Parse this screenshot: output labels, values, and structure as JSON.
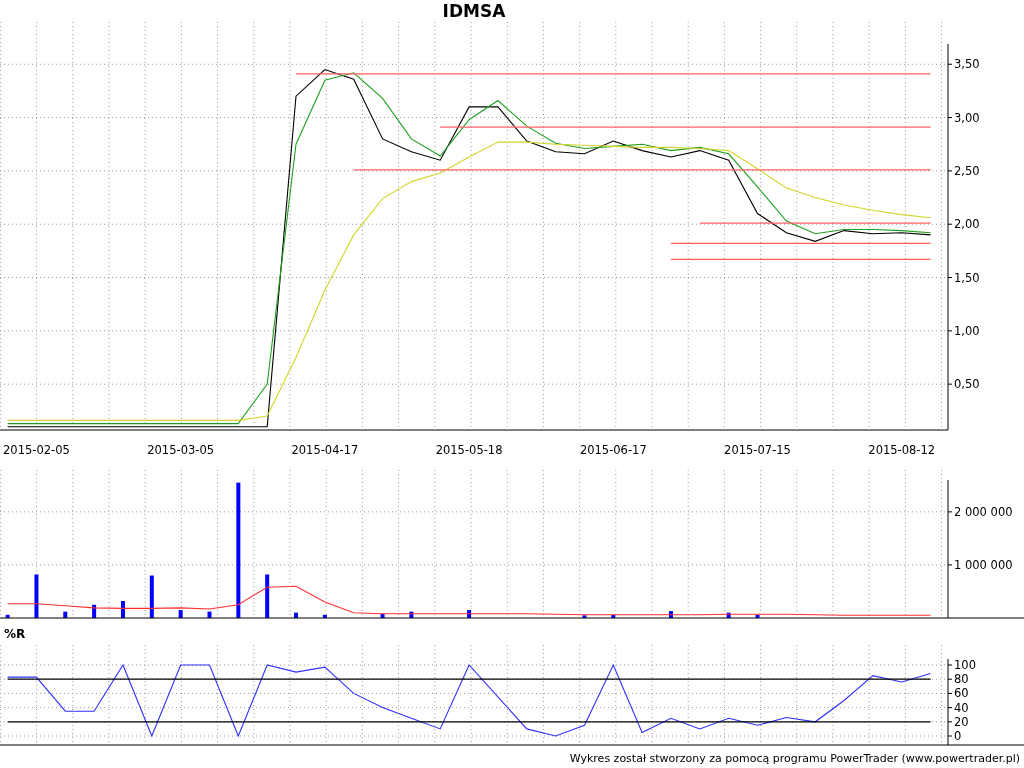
{
  "price_chart": {
    "chart_data": {
      "type": "line",
      "title": "IDMSA",
      "categories": [
        null,
        "2015-02-05",
        null,
        null,
        null,
        null,
        "2015-03-05",
        null,
        null,
        null,
        null,
        "2015-04-17",
        null,
        null,
        null,
        null,
        "2015-05-18",
        null,
        null,
        null,
        null,
        "2015-06-17",
        null,
        null,
        null,
        null,
        "2015-07-15",
        null,
        null,
        null,
        null,
        "2015-08-12",
        null
      ],
      "ylim": [
        0.07,
        3.69
      ],
      "grid": true,
      "yticks": [
        {
          "value": 0.5,
          "label": "0,50"
        },
        {
          "value": 1,
          "label": "1,00"
        },
        {
          "value": 1.5,
          "label": "1,50"
        },
        {
          "value": 2,
          "label": "2,00"
        },
        {
          "value": 2.5,
          "label": "2,50"
        },
        {
          "value": 3,
          "label": "3,00"
        },
        {
          "value": 3.5,
          "label": "3,50"
        }
      ],
      "series": [
        {
          "color": "#000000",
          "values": [
            0.1,
            0.1,
            0.1,
            0.1,
            0.1,
            0.1,
            0.1,
            0.1,
            0.1,
            0.1,
            3.2,
            3.45,
            3.36,
            2.8,
            2.68,
            2.6,
            3.1,
            3.1,
            2.78,
            2.68,
            2.66,
            2.78,
            2.69,
            2.63,
            2.69,
            2.6,
            2.1,
            1.92,
            1.84,
            1.94,
            1.91,
            1.92,
            1.9
          ]
        },
        {
          "color": "#1fa01f",
          "values": [
            0.13,
            0.13,
            0.13,
            0.13,
            0.13,
            0.13,
            0.13,
            0.13,
            0.13,
            0.5,
            2.75,
            3.35,
            3.42,
            3.18,
            2.8,
            2.64,
            2.98,
            3.16,
            2.92,
            2.76,
            2.71,
            2.73,
            2.75,
            2.69,
            2.72,
            2.66,
            2.35,
            2.03,
            1.91,
            1.95,
            1.95,
            1.94,
            1.92
          ]
        },
        {
          "color": "#d4d42a",
          "values": [
            0.16,
            0.16,
            0.16,
            0.16,
            0.16,
            0.16,
            0.16,
            0.16,
            0.16,
            0.2,
            0.75,
            1.38,
            1.9,
            2.24,
            2.4,
            2.48,
            2.63,
            2.77,
            2.77,
            2.75,
            2.74,
            2.73,
            2.72,
            2.72,
            2.71,
            2.69,
            2.52,
            2.34,
            2.25,
            2.18,
            2.13,
            2.09,
            2.06
          ]
        },
        {
          "color": "#ff6060",
          "values": [
            null,
            null,
            null,
            null,
            null,
            null,
            null,
            null,
            null,
            null,
            3.41,
            3.41,
            3.41,
            3.41,
            3.41,
            3.41,
            3.41,
            3.41,
            3.41,
            3.41,
            3.41,
            3.41,
            3.41,
            3.41,
            3.41,
            3.41,
            3.41,
            3.41,
            3.41,
            3.41,
            3.41,
            3.41,
            3.41
          ]
        },
        {
          "color": "#ff6060",
          "values": [
            null,
            null,
            null,
            null,
            null,
            null,
            null,
            null,
            null,
            null,
            null,
            null,
            null,
            null,
            null,
            2.91,
            2.91,
            2.91,
            2.91,
            2.91,
            2.91,
            2.91,
            2.91,
            2.91,
            2.91,
            2.91,
            2.91,
            2.91,
            2.91,
            2.91,
            2.91,
            2.91,
            2.91
          ]
        },
        {
          "color": "#ff6060",
          "values": [
            null,
            null,
            null,
            null,
            null,
            null,
            null,
            null,
            null,
            null,
            null,
            null,
            2.51,
            2.51,
            2.51,
            2.51,
            2.51,
            2.51,
            2.51,
            2.51,
            2.51,
            2.51,
            2.51,
            2.51,
            2.51,
            2.51,
            2.51,
            2.51,
            2.51,
            2.51,
            2.51,
            2.51,
            2.51
          ]
        },
        {
          "color": "#ff6060",
          "values": [
            null,
            null,
            null,
            null,
            null,
            null,
            null,
            null,
            null,
            null,
            null,
            null,
            null,
            null,
            null,
            null,
            null,
            null,
            null,
            null,
            null,
            null,
            null,
            null,
            2.01,
            2.01,
            2.01,
            2.01,
            2.01,
            2.01,
            2.01,
            2.01,
            2.01
          ]
        },
        {
          "color": "#ff6060",
          "values": [
            null,
            null,
            null,
            null,
            null,
            null,
            null,
            null,
            null,
            null,
            null,
            null,
            null,
            null,
            null,
            null,
            null,
            null,
            null,
            null,
            null,
            null,
            null,
            1.82,
            1.82,
            1.82,
            1.82,
            1.82,
            1.82,
            1.82,
            1.82,
            1.82,
            1.82
          ]
        },
        {
          "color": "#ff6060",
          "values": [
            null,
            null,
            null,
            null,
            null,
            null,
            null,
            null,
            null,
            null,
            null,
            null,
            null,
            null,
            null,
            null,
            null,
            null,
            null,
            null,
            null,
            null,
            null,
            1.67,
            1.67,
            1.67,
            1.67,
            1.67,
            1.67,
            1.67,
            1.67,
            1.67,
            1.67
          ]
        }
      ]
    }
  },
  "volume_chart": {
    "chart_data": {
      "type": "bar",
      "categories": [
        null,
        null,
        null,
        null,
        null,
        null,
        null,
        null,
        null,
        null,
        null,
        null,
        null,
        null,
        null,
        null,
        null,
        null,
        null,
        null,
        null,
        null,
        null,
        null,
        null,
        null,
        null,
        null,
        null,
        null,
        null,
        null,
        null
      ],
      "ylim": [
        0,
        2600000
      ],
      "grid": true,
      "yticks": [
        {
          "value": 1000000,
          "label": "1 000 000"
        },
        {
          "value": 2000000,
          "label": "2 000 000"
        }
      ],
      "series": [
        {
          "color": "#0000ff",
          "values": [
            60000,
            820000,
            120000,
            250000,
            320000,
            800000,
            150000,
            120000,
            2550000,
            820000,
            100000,
            60000,
            0,
            80000,
            120000,
            0,
            150000,
            0,
            0,
            0,
            50000,
            60000,
            0,
            130000,
            0,
            100000,
            60000,
            0,
            0,
            0,
            0,
            0,
            0
          ]
        },
        {
          "color": "#ff3030",
          "type": "line",
          "values": [
            270000,
            270000,
            230000,
            190000,
            180000,
            180000,
            190000,
            170000,
            250000,
            580000,
            600000,
            300000,
            100000,
            80000,
            80000,
            80000,
            80000,
            80000,
            80000,
            70000,
            60000,
            60000,
            60000,
            60000,
            60000,
            70000,
            70000,
            70000,
            60000,
            50000,
            50000,
            50000,
            50000
          ]
        }
      ]
    }
  },
  "indicator_chart": {
    "chart_data": {
      "type": "line",
      "title": "%R",
      "categories": [
        null,
        null,
        null,
        null,
        null,
        null,
        null,
        null,
        null,
        null,
        null,
        null,
        null,
        null,
        null,
        null,
        null,
        null,
        null,
        null,
        null,
        null,
        null,
        null,
        null,
        null,
        null,
        null,
        null,
        null,
        null,
        null,
        null
      ],
      "ylim": [
        0,
        100
      ],
      "grid": true,
      "yticks": [
        0,
        20,
        40,
        60,
        80,
        100
      ],
      "series": [
        {
          "color": "#3030ff",
          "values": [
            83,
            83,
            35,
            35,
            100,
            0,
            100,
            100,
            0,
            100,
            90,
            97,
            60,
            40,
            25,
            10,
            100,
            55,
            10,
            0,
            15,
            100,
            5,
            25,
            10,
            25,
            15,
            26,
            20,
            50,
            85,
            76,
            88
          ]
        },
        {
          "color": "#000000",
          "values": [
            80,
            80,
            80,
            80,
            80,
            80,
            80,
            80,
            80,
            80,
            80,
            80,
            80,
            80,
            80,
            80,
            80,
            80,
            80,
            80,
            80,
            80,
            80,
            80,
            80,
            80,
            80,
            80,
            80,
            80,
            80,
            80,
            80
          ]
        },
        {
          "color": "#000000",
          "values": [
            20,
            20,
            20,
            20,
            20,
            20,
            20,
            20,
            20,
            20,
            20,
            20,
            20,
            20,
            20,
            20,
            20,
            20,
            20,
            20,
            20,
            20,
            20,
            20,
            20,
            20,
            20,
            20,
            20,
            20,
            20,
            20,
            20
          ]
        }
      ]
    }
  },
  "footer": "Wykres został stworzony za pomocą programu PowerTrader (www.powertrader.pl)"
}
